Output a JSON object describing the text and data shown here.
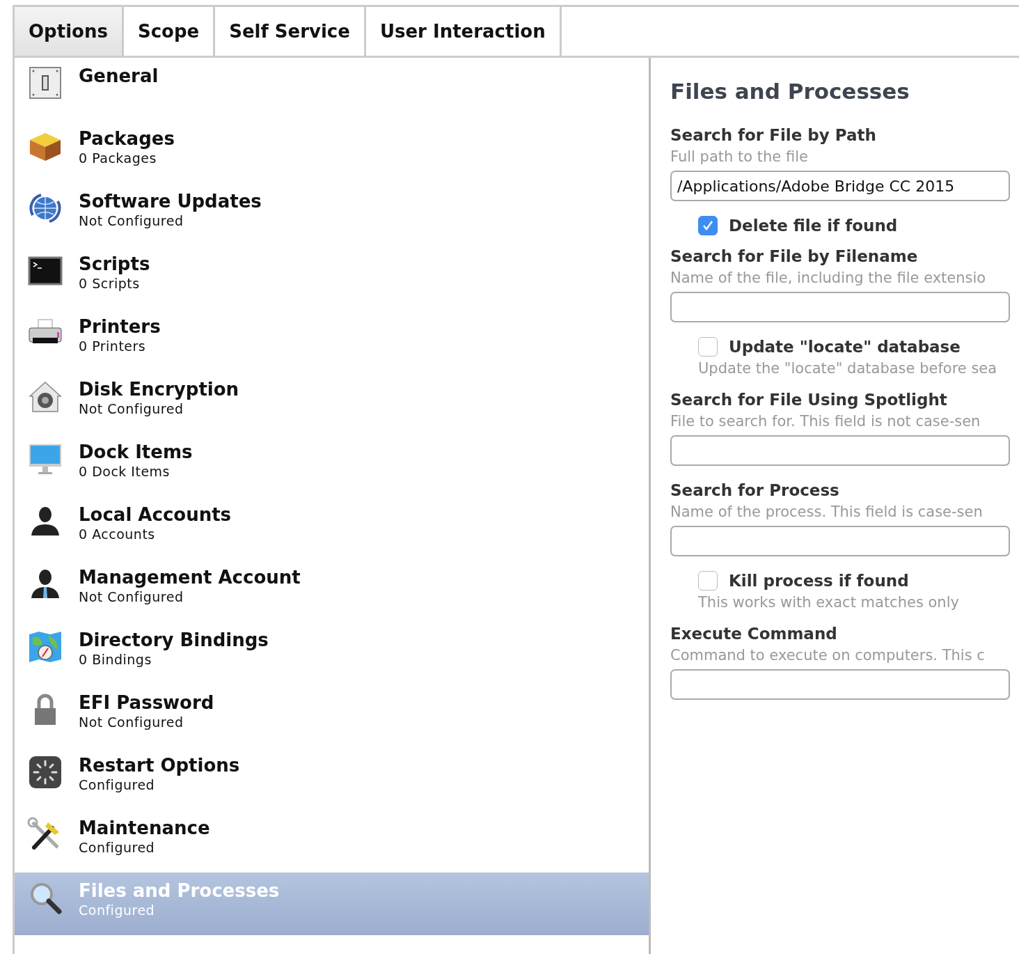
{
  "tabs": [
    {
      "label": "Options",
      "selected": true
    },
    {
      "label": "Scope",
      "selected": false
    },
    {
      "label": "Self Service",
      "selected": false
    },
    {
      "label": "User Interaction",
      "selected": false
    }
  ],
  "sidebar": {
    "items": [
      {
        "title": "General",
        "selected": false
      },
      {
        "title": "Packages",
        "subtitle": "0 Packages",
        "selected": false
      },
      {
        "title": "Software Updates",
        "subtitle": "Not Configured",
        "selected": false
      },
      {
        "title": "Scripts",
        "subtitle": "0 Scripts",
        "selected": false
      },
      {
        "title": "Printers",
        "subtitle": "0 Printers",
        "selected": false
      },
      {
        "title": "Disk Encryption",
        "subtitle": "Not Configured",
        "selected": false
      },
      {
        "title": "Dock Items",
        "subtitle": "0 Dock Items",
        "selected": false
      },
      {
        "title": "Local Accounts",
        "subtitle": "0 Accounts",
        "selected": false
      },
      {
        "title": "Management Account",
        "subtitle": "Not Configured",
        "selected": false
      },
      {
        "title": "Directory Bindings",
        "subtitle": "0 Bindings",
        "selected": false
      },
      {
        "title": "EFI Password",
        "subtitle": "Not Configured",
        "selected": false
      },
      {
        "title": "Restart Options",
        "subtitle": "Configured",
        "selected": false
      },
      {
        "title": "Maintenance",
        "subtitle": "Configured",
        "selected": false
      },
      {
        "title": "Files and Processes",
        "subtitle": "Configured",
        "selected": true
      }
    ]
  },
  "panel": {
    "title": "Files and Processes",
    "sections": [
      {
        "kind": "field",
        "label": "Search for File by Path",
        "hint": "Full path to the file",
        "value": "/Applications/Adobe Bridge CC 2015"
      },
      {
        "kind": "checkbox",
        "label": "Delete file if found",
        "checked": true
      },
      {
        "kind": "field",
        "label": "Search for File by Filename",
        "hint": "Name of the file, including the file extensio"
      },
      {
        "kind": "checkbox",
        "label": "Update \"locate\" database",
        "checked": false,
        "hint": "Update the \"locate\" database before sea"
      },
      {
        "kind": "field",
        "label": "Search for File Using Spotlight",
        "hint": "File to search for. This field is not case-sen"
      },
      {
        "kind": "field",
        "label": "Search for Process",
        "hint": "Name of the process. This field is case-sen"
      },
      {
        "kind": "checkbox",
        "label": "Kill process if found",
        "checked": false,
        "hint": "This works with exact matches only"
      },
      {
        "kind": "field",
        "label": "Execute Command",
        "hint": "Command to execute on computers. This c"
      }
    ]
  }
}
